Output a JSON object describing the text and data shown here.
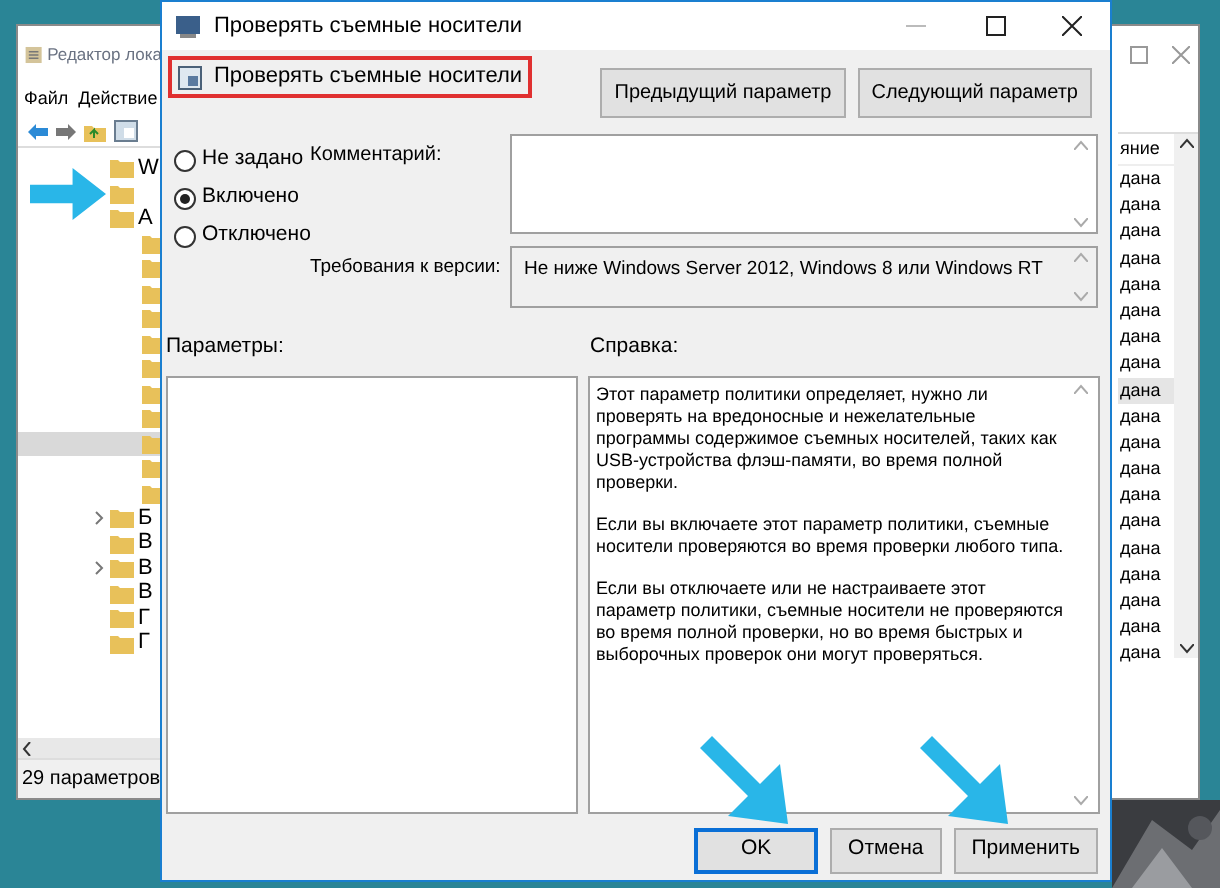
{
  "back_window": {
    "title": "Редактор лока",
    "menu": [
      "Файл",
      "Действие"
    ],
    "tree": [
      {
        "kind": "folder",
        "label": "W",
        "expandable": false,
        "selected": false
      },
      {
        "kind": "folder",
        "selected": false
      },
      {
        "kind": "folder",
        "label": "A",
        "expandable": false,
        "selected": false,
        "children": [
          {
            "kind": "folder",
            "selected": false
          },
          {
            "kind": "folder",
            "selected": false
          },
          {
            "kind": "folder",
            "selected": false
          },
          {
            "kind": "folder",
            "selected": false
          },
          {
            "kind": "folder",
            "selected": false
          },
          {
            "kind": "folder",
            "selected": false
          },
          {
            "kind": "folder",
            "selected": false
          },
          {
            "kind": "folder",
            "selected": false
          },
          {
            "kind": "folder",
            "selected": true
          },
          {
            "kind": "folder",
            "selected": false
          },
          {
            "kind": "folder",
            "selected": false
          }
        ]
      },
      {
        "kind": "folder",
        "label": "Б",
        "expandable": true,
        "selected": false
      },
      {
        "kind": "folder",
        "label": "В",
        "expandable": false,
        "selected": false
      },
      {
        "kind": "folder",
        "label": "В",
        "expandable": true,
        "selected": false
      },
      {
        "kind": "folder",
        "label": "В",
        "expandable": false,
        "selected": false
      },
      {
        "kind": "folder",
        "label": "Г",
        "expandable": false,
        "selected": false
      },
      {
        "kind": "folder",
        "label": "Г",
        "expandable": false,
        "selected": false
      }
    ],
    "status": "29 параметров",
    "column_header": "яние",
    "rows": [
      {
        "text": "дана",
        "selected": false
      },
      {
        "text": "дана",
        "selected": false
      },
      {
        "text": "дана",
        "selected": false
      },
      {
        "text": "дана",
        "selected": false
      },
      {
        "text": "дана",
        "selected": false
      },
      {
        "text": "дана",
        "selected": false
      },
      {
        "text": "дана",
        "selected": false
      },
      {
        "text": "дана",
        "selected": false
      },
      {
        "text": "дана",
        "selected": true
      },
      {
        "text": "дана",
        "selected": false
      },
      {
        "text": "дана",
        "selected": false
      },
      {
        "text": "дана",
        "selected": false
      },
      {
        "text": "дана",
        "selected": false
      },
      {
        "text": "дана",
        "selected": false
      },
      {
        "text": "дана",
        "selected": false
      },
      {
        "text": "дана",
        "selected": false
      },
      {
        "text": "дана",
        "selected": false
      },
      {
        "text": "дана",
        "selected": false
      },
      {
        "text": "дана",
        "selected": false
      }
    ]
  },
  "dialog": {
    "title": "Проверять съемные носители",
    "header_title": "Проверять съемные носители",
    "nav_buttons": [
      "Предыдущий параметр",
      "Следующий параметр"
    ],
    "options": [
      {
        "label": "Не задано",
        "selected": false
      },
      {
        "label": "Включено",
        "selected": true
      },
      {
        "label": "Отключено",
        "selected": false
      }
    ],
    "comment_label": "Комментарий:",
    "requirements_label": "Требования к версии:",
    "requirements": "Не ниже Windows Server 2012, Windows 8 или Windows RT",
    "parameters_label": "Параметры:",
    "help_label": "Справка:",
    "help_paragraphs": [
      "Этот параметр политики определяет, нужно ли проверять на вредоносные и нежелательные программы содержимое съемных носителей, таких как USB-устройства флэш-памяти, во время полной проверки.",
      "Если вы включаете этот параметр политики, съемные носители проверяются во время проверки любого типа.",
      "Если вы отключаете или не настраиваете этот параметр политики, съемные носители не проверяются во время полной проверки, но во время быстрых и выборочных проверок они могут проверяться."
    ],
    "buttons": [
      {
        "label": "OK",
        "default": true
      },
      {
        "label": "Отмена",
        "default": false
      },
      {
        "label": "Применить",
        "default": false
      }
    ]
  }
}
